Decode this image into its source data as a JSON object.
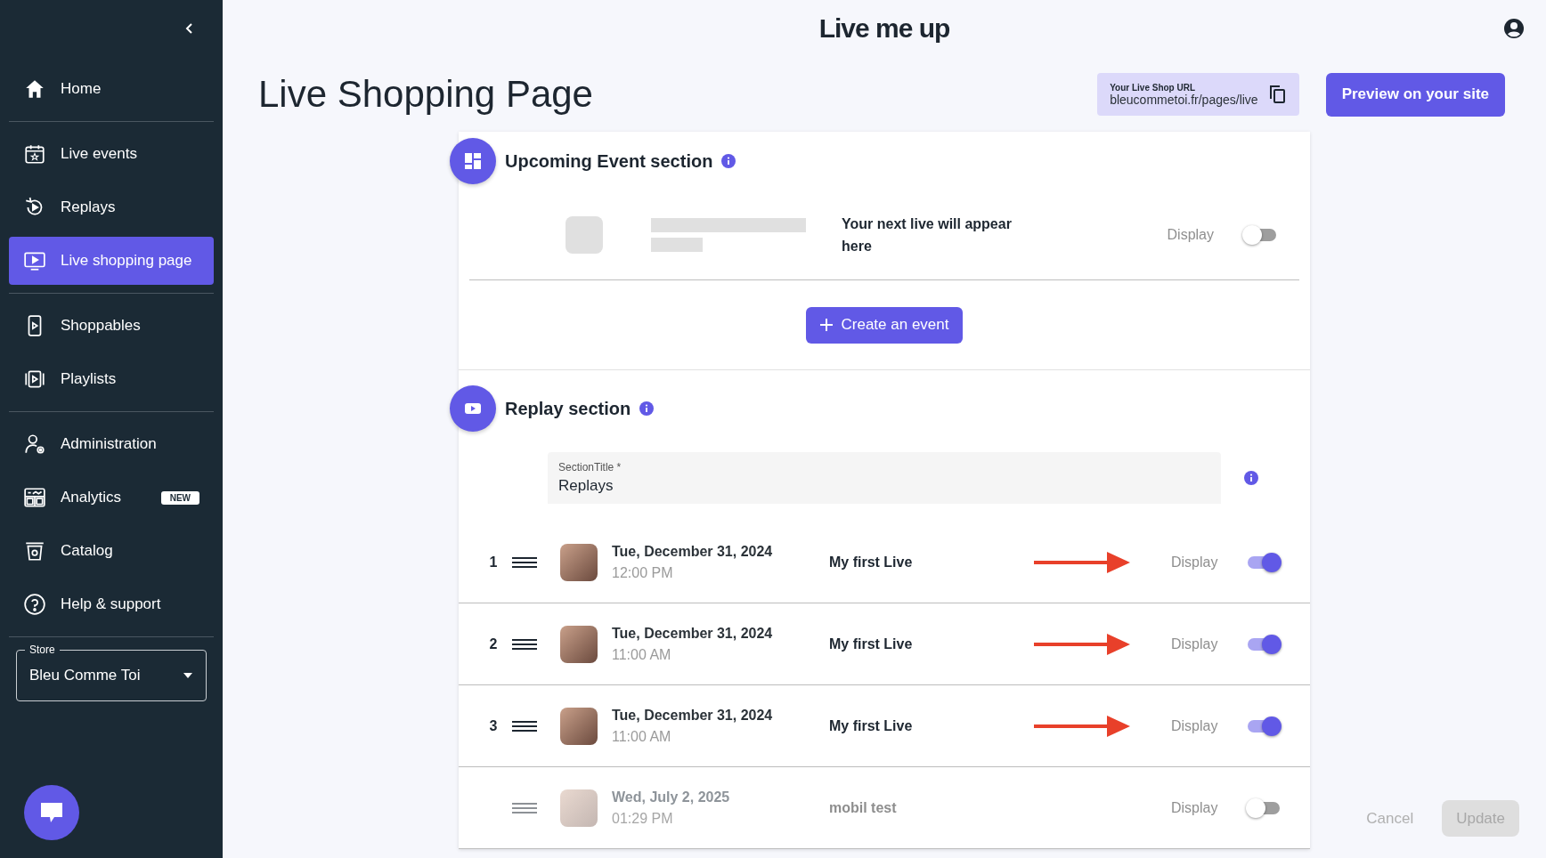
{
  "sidebar": {
    "groups": [
      {
        "items": [
          {
            "label": "Home",
            "selected": false
          }
        ]
      },
      {
        "items": [
          {
            "label": "Live events",
            "selected": false
          },
          {
            "label": "Replays",
            "selected": false
          },
          {
            "label": "Live shopping page",
            "selected": true
          }
        ]
      },
      {
        "items": [
          {
            "label": "Shoppables",
            "selected": false
          },
          {
            "label": "Playlists",
            "selected": false
          }
        ]
      },
      {
        "items": [
          {
            "label": "Administration",
            "selected": false
          },
          {
            "label": "Analytics",
            "selected": false,
            "badge": "NEW"
          },
          {
            "label": "Catalog",
            "selected": false
          },
          {
            "label": "Help & support",
            "selected": false
          }
        ]
      }
    ],
    "store": {
      "label": "Store",
      "value": "Bleu Comme Toi"
    }
  },
  "header": {
    "logo": "Live me up"
  },
  "page": {
    "title": "Live Shopping Page",
    "url_label": "Your Live Shop URL",
    "url": "bleucommetoi.fr/pages/live",
    "preview_button": "Preview on your site"
  },
  "upcoming": {
    "title": "Upcoming Event section",
    "placeholder_text": "Your next live will appear here",
    "display_label": "Display",
    "display": false,
    "create_button": "Create an event"
  },
  "replay": {
    "title": "Replay section",
    "field": {
      "label": "SectionTitle *",
      "value": "Replays"
    },
    "rows": [
      {
        "number": "1",
        "date": "Tue, December 31, 2024",
        "time": "12:00 PM",
        "title": "My first Live",
        "annotated": true,
        "display_label": "Display",
        "display": true
      },
      {
        "number": "2",
        "date": "Tue, December 31, 2024",
        "time": "11:00 AM",
        "title": "My first Live",
        "annotated": true,
        "display_label": "Display",
        "display": true
      },
      {
        "number": "3",
        "date": "Tue, December 31, 2024",
        "time": "11:00 AM",
        "title": "My first Live",
        "annotated": true,
        "display_label": "Display",
        "display": true
      },
      {
        "date": "Wed, July 2, 2025",
        "time": "01:29 PM",
        "title": "mobil test",
        "annotated": false,
        "display_label": "Display",
        "display": false
      }
    ]
  },
  "footer": {
    "cancel": "Cancel",
    "update": "Update",
    "update_disabled": true
  }
}
